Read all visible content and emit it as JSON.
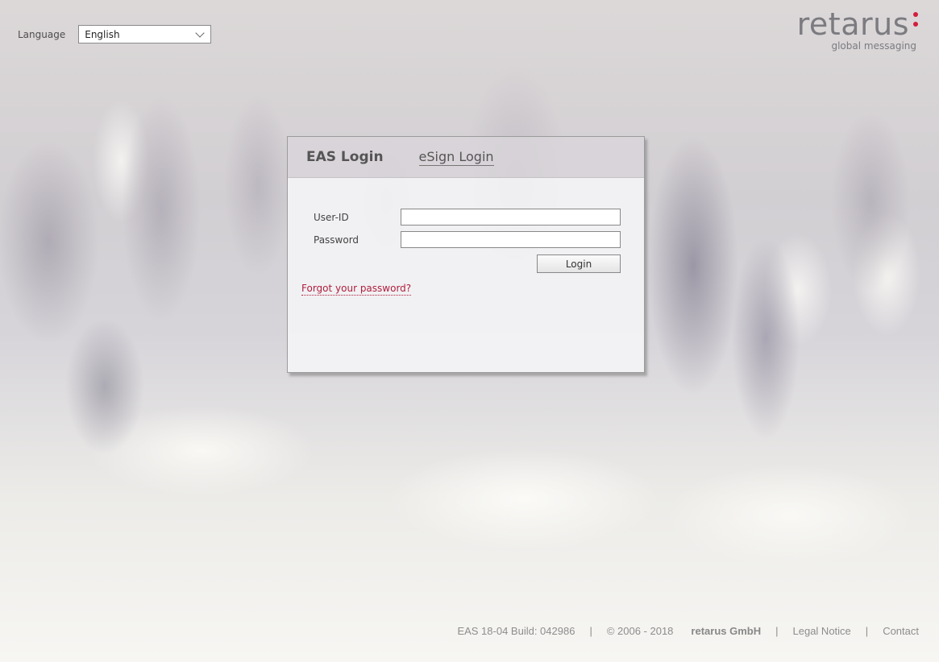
{
  "language": {
    "label": "Language",
    "selected": "English"
  },
  "logo": {
    "wordmark": "retarus",
    "tagline": "global messaging",
    "accent_color": "#d21f3c"
  },
  "login_panel": {
    "tabs": [
      {
        "label": "EAS Login",
        "active": true
      },
      {
        "label": "eSign Login",
        "active": false
      }
    ],
    "fields": {
      "user_id": {
        "label": "User-ID",
        "value": ""
      },
      "password": {
        "label": "Password",
        "value": ""
      }
    },
    "login_button": "Login",
    "forgot_link": "Forgot your password?",
    "forgot_link_color": "#b01e3d"
  },
  "footer": {
    "build": "EAS 18-04 Build: 042986",
    "separator": "|",
    "copyright": "© 2006 - 2018",
    "company": "retarus GmbH",
    "legal_notice": "Legal Notice",
    "contact": "Contact"
  }
}
